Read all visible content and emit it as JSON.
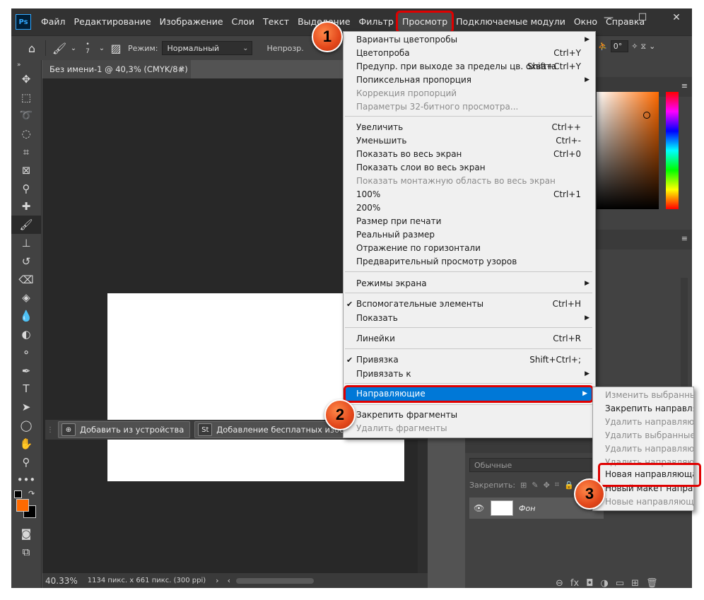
{
  "app": {
    "logo": "Ps"
  },
  "menubar": {
    "items": [
      "Файл",
      "Редактирование",
      "Изображение",
      "Слои",
      "Текст",
      "Выделение",
      "Фильтр",
      "Просмотр",
      "Подключаемые модули",
      "Окно",
      "Справка"
    ],
    "active": "Просмотр"
  },
  "options": {
    "mode_label": "Режим:",
    "mode_value": "Нормальный",
    "opacity_label": "Непрозр.",
    "brush_size": "7",
    "angle": "0°"
  },
  "document": {
    "tab_title": "Без имени-1 @ 40,3% (CMYK/8#)",
    "zoom": "40.33%",
    "info": "1134 пикс. x 661 пикс. (300 ppi)"
  },
  "taskbar": {
    "add_device": "Добавить из устройства",
    "add_free": "Добавление бесплатных изображени"
  },
  "view_menu": {
    "items": [
      {
        "label": "Варианты цветопробы",
        "shortcut": "",
        "arrow": true,
        "disabled": false,
        "check": false
      },
      {
        "label": "Цветопроба",
        "shortcut": "Ctrl+Y",
        "arrow": false,
        "disabled": false,
        "check": false
      },
      {
        "label": "Предупр. при выходе за пределы цв. охвата",
        "shortcut": "Shift+Ctrl+Y",
        "arrow": false,
        "disabled": false,
        "check": false
      },
      {
        "label": "Попиксельная пропорция",
        "shortcut": "",
        "arrow": true,
        "disabled": false,
        "check": false
      },
      {
        "label": "Коррекция пропорций",
        "shortcut": "",
        "arrow": false,
        "disabled": true,
        "check": false
      },
      {
        "label": "Параметры 32-битного просмотра...",
        "shortcut": "",
        "arrow": false,
        "disabled": true,
        "check": false
      },
      {
        "label": "Увеличить",
        "shortcut": "Ctrl++",
        "arrow": false,
        "disabled": false,
        "check": false
      },
      {
        "label": "Уменьшить",
        "shortcut": "Ctrl+-",
        "arrow": false,
        "disabled": false,
        "check": false
      },
      {
        "label": "Показать во весь экран",
        "shortcut": "Ctrl+0",
        "arrow": false,
        "disabled": false,
        "check": false
      },
      {
        "label": "Показать слои во весь экран",
        "shortcut": "",
        "arrow": false,
        "disabled": false,
        "check": false
      },
      {
        "label": "Показать монтажную область во весь экран",
        "shortcut": "",
        "arrow": false,
        "disabled": true,
        "check": false
      },
      {
        "label": "100%",
        "shortcut": "Ctrl+1",
        "arrow": false,
        "disabled": false,
        "check": false
      },
      {
        "label": "200%",
        "shortcut": "",
        "arrow": false,
        "disabled": false,
        "check": false
      },
      {
        "label": "Размер при печати",
        "shortcut": "",
        "arrow": false,
        "disabled": false,
        "check": false
      },
      {
        "label": "Реальный размер",
        "shortcut": "",
        "arrow": false,
        "disabled": false,
        "check": false
      },
      {
        "label": "Отражение по горизонтали",
        "shortcut": "",
        "arrow": false,
        "disabled": false,
        "check": false
      },
      {
        "label": "Предварительный просмотр узоров",
        "shortcut": "",
        "arrow": false,
        "disabled": false,
        "check": false
      },
      {
        "label": "Режимы экрана",
        "shortcut": "",
        "arrow": true,
        "disabled": false,
        "check": false
      },
      {
        "label": "Вспомогательные элементы",
        "shortcut": "Ctrl+H",
        "arrow": false,
        "disabled": false,
        "check": true
      },
      {
        "label": "Показать",
        "shortcut": "",
        "arrow": true,
        "disabled": false,
        "check": false
      },
      {
        "label": "Линейки",
        "shortcut": "Ctrl+R",
        "arrow": false,
        "disabled": false,
        "check": false
      },
      {
        "label": "Привязка",
        "shortcut": "Shift+Ctrl+;",
        "arrow": false,
        "disabled": false,
        "check": true
      },
      {
        "label": "Привязать к",
        "shortcut": "",
        "arrow": true,
        "disabled": false,
        "check": false
      },
      {
        "label": "Направляющие",
        "shortcut": "",
        "arrow": true,
        "disabled": false,
        "check": false,
        "highlighted": true
      },
      {
        "label": "Закрепить фрагменты",
        "shortcut": "",
        "arrow": false,
        "disabled": false,
        "check": false
      },
      {
        "label": "Удалить фрагменты",
        "shortcut": "",
        "arrow": false,
        "disabled": true,
        "check": false
      }
    ]
  },
  "guides_submenu": {
    "items": [
      {
        "label": "Изменить выбранные",
        "disabled": true
      },
      {
        "label": "Закрепить направляю",
        "disabled": false
      },
      {
        "label": "Удалить направляющ",
        "disabled": true
      },
      {
        "label": "Удалить выбранные на",
        "disabled": true
      },
      {
        "label": "Удалить направляющ",
        "disabled": true
      },
      {
        "label": "Удалить направляющ",
        "disabled": true
      },
      {
        "label": "Новая направляющая...",
        "disabled": false,
        "highlighted": true
      },
      {
        "label": "Новый макет направл",
        "disabled": false
      },
      {
        "label": "Новые направляющие",
        "disabled": true
      }
    ]
  },
  "layers": {
    "blend_mode": "Обычные",
    "lock_label": "Закрепить:",
    "layer_name": "Фон"
  },
  "steps": [
    "1",
    "2",
    "3"
  ],
  "colors": {
    "foreground": "#ff6a00",
    "background": "#000000",
    "menu_highlight": "#0078d7",
    "callout": "#e00000"
  }
}
